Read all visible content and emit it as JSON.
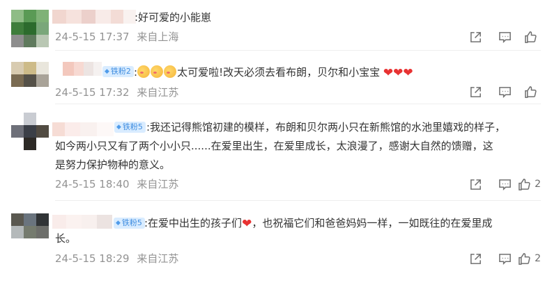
{
  "comments": [
    {
      "text_lines": [
        ":好可爱的小能崽"
      ],
      "date": "24-5-15 17:37",
      "location": "来自上海",
      "like_count": ""
    },
    {
      "badge": "铁粉2",
      "text_prefix": ":",
      "text_main": "太可爱啦!改天必须去看布朗，贝尔和小宝宝",
      "date": "24-5-15 17:32",
      "location": "来自江苏",
      "like_count": ""
    },
    {
      "badge": "铁粉5",
      "text_lines": [
        ":我还记得熊馆初建的模样，布朗和贝尔两小只在新熊馆的水池里嬉戏的样子，",
        "如今两小只又有了两个小小只......在爱里出生，在爱里成长，太浪漫了，感谢大自然的馈赠，这",
        "是努力保护物种的意义。"
      ],
      "date": "24-5-15 18:40",
      "location": "来自江苏",
      "like_count": "2"
    },
    {
      "badge": "铁粉5",
      "text_a": ":在爱中出生的孩子们",
      "text_b": "，也祝福它们和爸爸妈妈一样，一如既往的在爱里成",
      "text_line2": "长。",
      "date": "24-5-15 18:29",
      "location": "来自江苏",
      "like_count": "2"
    }
  ],
  "icons": [
    "share-icon",
    "comment-icon",
    "like-icon",
    "heart-emoji",
    "blush-emoji"
  ],
  "colors": {
    "meta": "#939393",
    "badge_bg": "#d9ecff",
    "badge_text": "#3f8de0",
    "heart": "#e83232"
  }
}
